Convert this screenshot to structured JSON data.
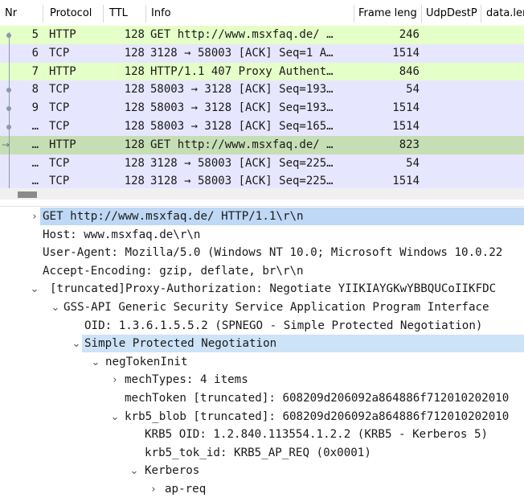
{
  "packet_list": {
    "columns": [
      "Nr",
      "Protocol",
      "TTL",
      "Info",
      "Frame leng",
      "UdpDestP",
      "data.len"
    ],
    "rows": [
      {
        "nr": "5",
        "protocol": "HTTP",
        "ttl": "128",
        "info": "GET http://www.msxfaq.de/ …",
        "length": "246",
        "bg": "#e4ffc7"
      },
      {
        "nr": "6",
        "protocol": "TCP",
        "ttl": "128",
        "info": "3128 → 58003 [ACK] Seq=1 A…",
        "length": "1514",
        "bg": "#e7e6ff"
      },
      {
        "nr": "7",
        "protocol": "HTTP",
        "ttl": "128",
        "info": "HTTP/1.1 407 Proxy Authent…",
        "length": "846",
        "bg": "#e4ffc7"
      },
      {
        "nr": "8",
        "protocol": "TCP",
        "ttl": "128",
        "info": "58003 → 3128 [ACK] Seq=193…",
        "length": "54",
        "bg": "#e7e6ff"
      },
      {
        "nr": "9",
        "protocol": "TCP",
        "ttl": "128",
        "info": "58003 → 3128 [ACK] Seq=193…",
        "length": "1514",
        "bg": "#e7e6ff"
      },
      {
        "nr": "…",
        "protocol": "TCP",
        "ttl": "128",
        "info": "58003 → 3128 [ACK] Seq=165…",
        "length": "1514",
        "bg": "#e7e6ff"
      },
      {
        "nr": "…",
        "protocol": "HTTP",
        "ttl": "128",
        "info": "GET http://www.msxfaq.de/ …",
        "length": "823",
        "bg": "#c6deb4"
      },
      {
        "nr": "…",
        "protocol": "TCP",
        "ttl": "128",
        "info": "3128 → 58003 [ACK] Seq=225…",
        "length": "54",
        "bg": "#e7e6ff"
      },
      {
        "nr": "…",
        "protocol": "TCP",
        "ttl": "128",
        "info": "3128 → 58003 [ACK] Seq=225…",
        "length": "1514",
        "bg": "#e7e6ff"
      }
    ]
  },
  "details": {
    "nodes": [
      {
        "text": "GET http://www.msxfaq.de/ HTTP/1.1\\r\\n",
        "expander": "›",
        "highlight": true
      },
      {
        "text": "Host: www.msxfaq.de\\r\\n",
        "expander": ""
      },
      {
        "text": "User-Agent: Mozilla/5.0 (Windows NT 10.0; Microsoft Windows 10.0.22",
        "expander": ""
      },
      {
        "text": "Accept-Encoding: gzip, deflate, br\\r\\n",
        "expander": ""
      },
      {
        "text": "[truncated]Proxy-Authorization: Negotiate YIIKIAYGKwYBBQUCoIIKFDC",
        "expander": "⌄"
      },
      {
        "text": "GSS-API Generic Security Service Application Program Interface",
        "expander": "⌄"
      },
      {
        "text": "OID: 1.3.6.1.5.5.2 (SPNEGO - Simple Protected Negotiation)",
        "expander": ""
      },
      {
        "text": "Simple Protected Negotiation",
        "expander": "⌄",
        "highlight": true
      },
      {
        "text": "negTokenInit",
        "expander": "⌄"
      },
      {
        "text": "mechTypes: 4 items",
        "expander": "›"
      },
      {
        "text": "mechToken [truncated]: 608209d206092a864886f712010202010",
        "expander": ""
      },
      {
        "text": "krb5_blob [truncated]: 608209d206092a864886f712010202010",
        "expander": "⌄"
      },
      {
        "text": "KRB5 OID: 1.2.840.113554.1.2.2 (KRB5 - Kerberos 5)",
        "expander": ""
      },
      {
        "text": "krb5_tok_id: KRB5_AP_REQ (0x0001)",
        "expander": ""
      },
      {
        "text": "Kerberos",
        "expander": "⌄"
      },
      {
        "text": "ap-req",
        "expander": "›"
      }
    ]
  }
}
